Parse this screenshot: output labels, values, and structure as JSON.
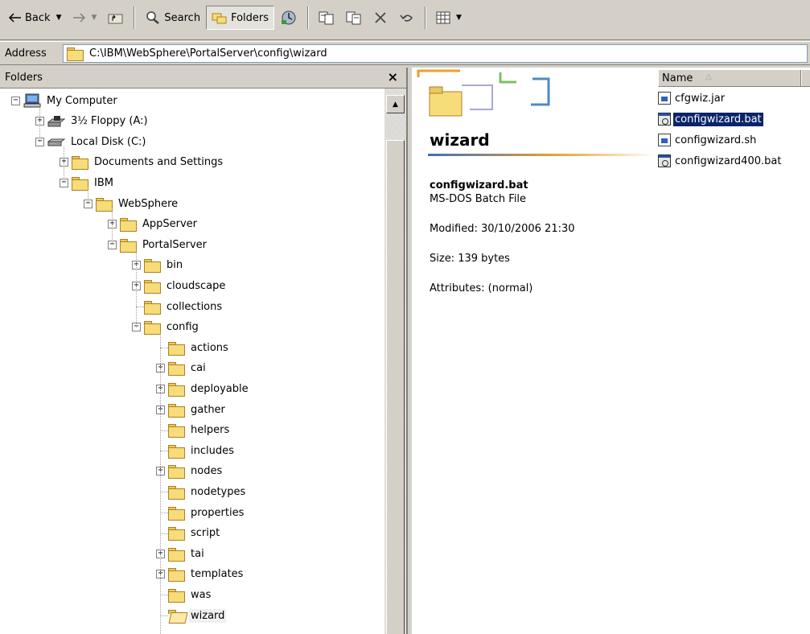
{
  "toolbar": {
    "back_label": "Back",
    "search_label": "Search",
    "folders_label": "Folders"
  },
  "address": {
    "label": "Address",
    "path": "C:\\IBM\\WebSphere\\PortalServer\\config\\wizard"
  },
  "folders_pane": {
    "title": "Folders",
    "close_symbol": "×",
    "tree": [
      {
        "label": "My Computer",
        "level": 0,
        "expander": "minus",
        "icon": "computer-icon"
      },
      {
        "label": "3½ Floppy (A:)",
        "level": 1,
        "expander": "plus",
        "icon": "floppy-drive-icon"
      },
      {
        "label": "Local Disk (C:)",
        "level": 1,
        "expander": "minus",
        "icon": "hard-disk-icon"
      },
      {
        "label": "Documents and Settings",
        "level": 2,
        "expander": "plus",
        "icon": "folder-icon"
      },
      {
        "label": "IBM",
        "level": 2,
        "expander": "minus",
        "icon": "folder-icon"
      },
      {
        "label": "WebSphere",
        "level": 3,
        "expander": "minus",
        "icon": "folder-icon"
      },
      {
        "label": "AppServer",
        "level": 4,
        "expander": "plus",
        "icon": "folder-icon"
      },
      {
        "label": "PortalServer",
        "level": 4,
        "expander": "minus",
        "icon": "folder-icon"
      },
      {
        "label": "bin",
        "level": 5,
        "expander": "plus",
        "icon": "folder-icon"
      },
      {
        "label": "cloudscape",
        "level": 5,
        "expander": "plus",
        "icon": "folder-icon"
      },
      {
        "label": "collections",
        "level": 5,
        "expander": "none",
        "icon": "folder-icon"
      },
      {
        "label": "config",
        "level": 5,
        "expander": "minus",
        "icon": "folder-icon"
      },
      {
        "label": "actions",
        "level": 6,
        "expander": "none",
        "icon": "folder-icon"
      },
      {
        "label": "cai",
        "level": 6,
        "expander": "plus",
        "icon": "folder-icon"
      },
      {
        "label": "deployable",
        "level": 6,
        "expander": "plus",
        "icon": "folder-icon"
      },
      {
        "label": "gather",
        "level": 6,
        "expander": "plus",
        "icon": "folder-icon"
      },
      {
        "label": "helpers",
        "level": 6,
        "expander": "none",
        "icon": "folder-icon"
      },
      {
        "label": "includes",
        "level": 6,
        "expander": "none",
        "icon": "folder-icon"
      },
      {
        "label": "nodes",
        "level": 6,
        "expander": "plus",
        "icon": "folder-icon"
      },
      {
        "label": "nodetypes",
        "level": 6,
        "expander": "none",
        "icon": "folder-icon"
      },
      {
        "label": "properties",
        "level": 6,
        "expander": "none",
        "icon": "folder-icon"
      },
      {
        "label": "script",
        "level": 6,
        "expander": "none",
        "icon": "folder-icon"
      },
      {
        "label": "tai",
        "level": 6,
        "expander": "plus",
        "icon": "folder-icon"
      },
      {
        "label": "templates",
        "level": 6,
        "expander": "plus",
        "icon": "folder-icon"
      },
      {
        "label": "was",
        "level": 6,
        "expander": "none",
        "icon": "folder-icon"
      },
      {
        "label": "wizard",
        "level": 6,
        "expander": "none",
        "icon": "open-folder-icon",
        "selected": true
      }
    ]
  },
  "details": {
    "folder_title": "wizard",
    "file_name": "configwizard.bat",
    "file_type": "MS-DOS Batch File",
    "modified": "Modified: 30/10/2006 21:30",
    "size": "Size: 139 bytes",
    "attributes": "Attributes: (normal)"
  },
  "file_list": {
    "column_name": "Name",
    "sort_indicator": "△",
    "files": [
      {
        "name": "cfgwiz.jar",
        "type": "jar"
      },
      {
        "name": "configwizard.bat",
        "type": "bat",
        "selected": true
      },
      {
        "name": "configwizard.sh",
        "type": "jar"
      },
      {
        "name": "configwizard400.bat",
        "type": "bat"
      }
    ]
  }
}
